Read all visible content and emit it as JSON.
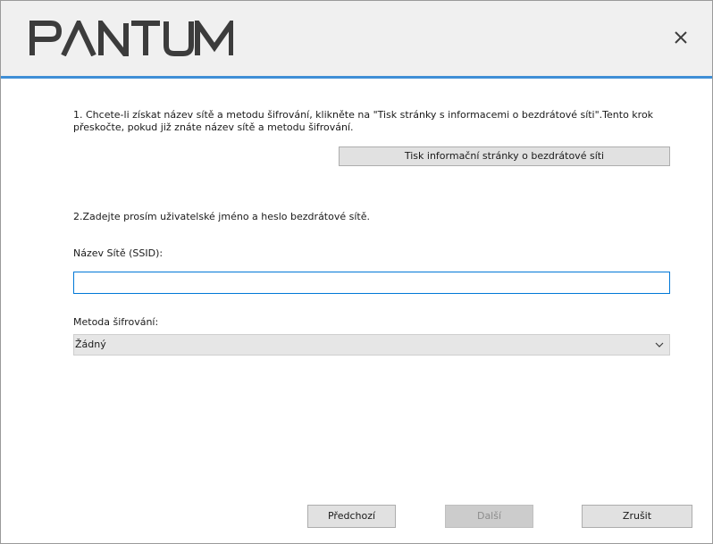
{
  "header": {
    "brand": "PANTUM",
    "close_label": "×"
  },
  "step1": {
    "instruction": "1. Chcete-li získat název sítě a metodu šifrování, klikněte na \"Tisk stránky s informacemi o bezdrátové síti\".Tento krok přeskočte, pokud již znáte název sítě a metodu šifrování.",
    "print_button_label": "Tisk informační stránky o bezdrátové síti"
  },
  "step2": {
    "instruction": "2.Zadejte prosím uživatelské jméno a heslo bezdrátové sítě.",
    "ssid_label": "Název Sítě (SSID):",
    "ssid_value": "",
    "encryption_label": "Metoda šifrování:",
    "encryption_selected": "Žádný"
  },
  "footer": {
    "prev_label": "Předchozí",
    "next_label": "Další",
    "cancel_label": "Zrušit"
  },
  "colors": {
    "accent_line": "#3f8fd6",
    "logo": "#3c3c3c",
    "input_focus_border": "#0078d7",
    "disabled_text": "#8d8d8d"
  },
  "icons": {
    "close": "close-icon",
    "dropdown": "chevron-down-icon"
  }
}
